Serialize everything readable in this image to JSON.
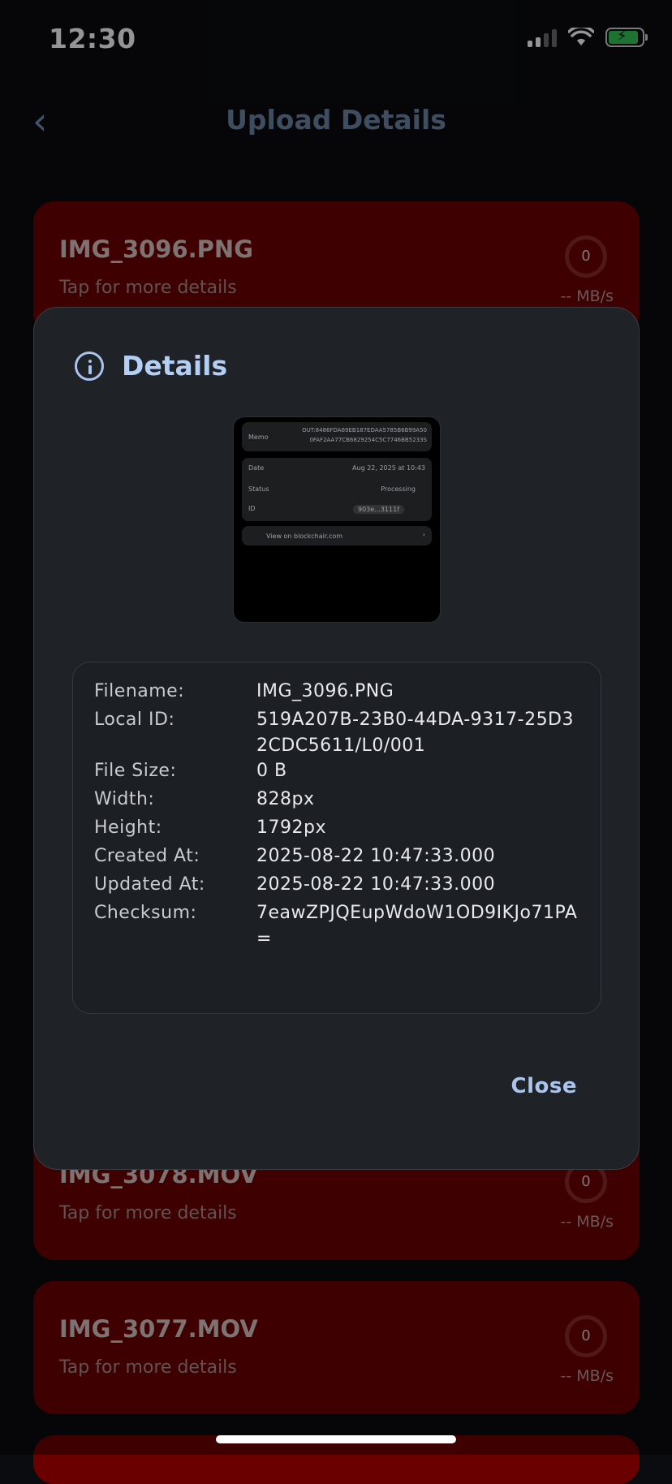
{
  "status_bar": {
    "time": "12:30"
  },
  "nav": {
    "title": "Upload Details"
  },
  "cards": [
    {
      "name": "IMG_3096.PNG",
      "subtitle": "Tap for more details",
      "progress": "0",
      "rate": "-- MB/s"
    },
    {
      "name": "IMG_3078.MOV",
      "subtitle": "Tap for more details",
      "progress": "0",
      "rate": "-- MB/s"
    },
    {
      "name": "IMG_3077.MOV",
      "subtitle": "Tap for more details",
      "progress": "0",
      "rate": "-- MB/s"
    }
  ],
  "dialog": {
    "title": "Details",
    "preview": {
      "memo_label": "Memo",
      "memo_line1": "OUT:8486FDA69EB187EDAA5785B6B99A50",
      "memo_line2": "0FAF2AA77CB6829254C5C7746BB5233S",
      "date_label": "Date",
      "date_value": "Aug 22, 2025 at 10:43",
      "status_label": "Status",
      "status_value": "Processing",
      "id_label": "ID",
      "id_value": "903e...3111f",
      "link_label": "View on blockchair.com"
    },
    "fields": [
      {
        "label": "Filename:",
        "value": "IMG_3096.PNG"
      },
      {
        "label": "Local ID:",
        "value": "519A207B-23B0-44DA-9317-25D32CDC5611/L0/001"
      },
      {
        "label": "File Size:",
        "value": "0 B"
      },
      {
        "label": "Width:",
        "value": "828px"
      },
      {
        "label": "Height:",
        "value": "1792px"
      },
      {
        "label": "Created At:",
        "value": "2025-08-22 10:47:33.000"
      },
      {
        "label": "Updated At:",
        "value": "2025-08-22 10:47:33.000"
      },
      {
        "label": "Checksum:",
        "value": "7eawZPJQEupWdoW1OD9IKJo71PA="
      }
    ],
    "close_label": "Close"
  }
}
